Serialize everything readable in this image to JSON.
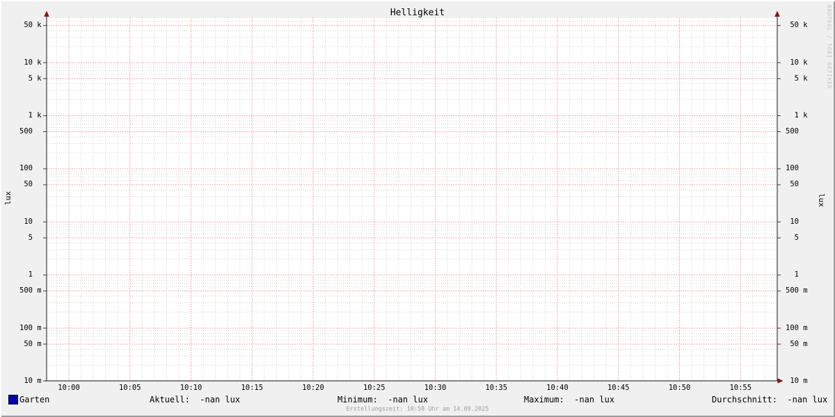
{
  "title": "Helligkeit",
  "watermark": "RRDTOOL / TOBI OETIKER",
  "axis": {
    "y_unit_left": "lux",
    "y_unit_right": "lux",
    "y_ticks": [
      {
        "value": 50000,
        "label": " 50 k"
      },
      {
        "value": 10000,
        "label": " 10 k"
      },
      {
        "value": 5000,
        "label": "  5 k"
      },
      {
        "value": 1000,
        "label": "  1 k"
      },
      {
        "value": 500,
        "label": "500"
      },
      {
        "value": 100,
        "label": "100"
      },
      {
        "value": 50,
        "label": " 50"
      },
      {
        "value": 10,
        "label": " 10"
      },
      {
        "value": 5,
        "label": "  5"
      },
      {
        "value": 1,
        "label": "  1"
      },
      {
        "value": 0.5,
        "label": "500 m"
      },
      {
        "value": 0.1,
        "label": "100 m"
      },
      {
        "value": 0.05,
        "label": " 50 m"
      },
      {
        "value": 0.01,
        "label": " 10 m"
      }
    ],
    "x_ticks": [
      {
        "minute": 0,
        "label": "10:00"
      },
      {
        "minute": 5,
        "label": "10:05"
      },
      {
        "minute": 10,
        "label": "10:10"
      },
      {
        "minute": 15,
        "label": "10:15"
      },
      {
        "minute": 20,
        "label": "10:20"
      },
      {
        "minute": 25,
        "label": "10:25"
      },
      {
        "minute": 30,
        "label": "10:30"
      },
      {
        "minute": 35,
        "label": "10:35"
      },
      {
        "minute": 40,
        "label": "10:40"
      },
      {
        "minute": 45,
        "label": "10:45"
      },
      {
        "minute": 50,
        "label": "10:50"
      },
      {
        "minute": 55,
        "label": "10:55"
      }
    ]
  },
  "legend": {
    "series_label": "Garten",
    "aktuell": "Aktuell:  -nan lux",
    "minimum": "Minimum:  -nan lux",
    "maximum": "Maximum:  -nan lux",
    "durchschnitt": "Durchschnitt:  -nan lux"
  },
  "footer": "Erstellungszeit: 10:58 Uhr am 14.09.2025",
  "colors": {
    "background": "#f0f0f0",
    "canvas": "#ffffff",
    "major_grid": "#ee9595",
    "minor_grid": "#d2d2d6",
    "axis": "#3c3c3c",
    "arrow": "#8b1515",
    "series": "#0000b4",
    "footer_text": "#a0a0a0",
    "watermark_text": "#c4c4c4"
  },
  "chart_data": {
    "type": "line",
    "title": "Helligkeit",
    "xlabel": "",
    "ylabel": "lux",
    "y_scale": "log",
    "ylim": [
      0.01,
      50000
    ],
    "grid": true,
    "legend_position": "bottom",
    "x_tick_labels": [
      "10:00",
      "10:05",
      "10:10",
      "10:15",
      "10:20",
      "10:25",
      "10:30",
      "10:35",
      "10:40",
      "10:45",
      "10:50",
      "10:55"
    ],
    "y_tick_labels": [
      "10 m",
      "50 m",
      "100 m",
      "500 m",
      "1",
      "5",
      "10",
      "50",
      "100",
      "500",
      "1 k",
      "5 k",
      "10 k",
      "50 k"
    ],
    "series": [
      {
        "name": "Garten",
        "color": "#0000b4",
        "x": [],
        "y": []
      }
    ],
    "stats": {
      "aktuell": "-nan lux",
      "minimum": "-nan lux",
      "maximum": "-nan lux",
      "durchschnitt": "-nan lux"
    }
  }
}
